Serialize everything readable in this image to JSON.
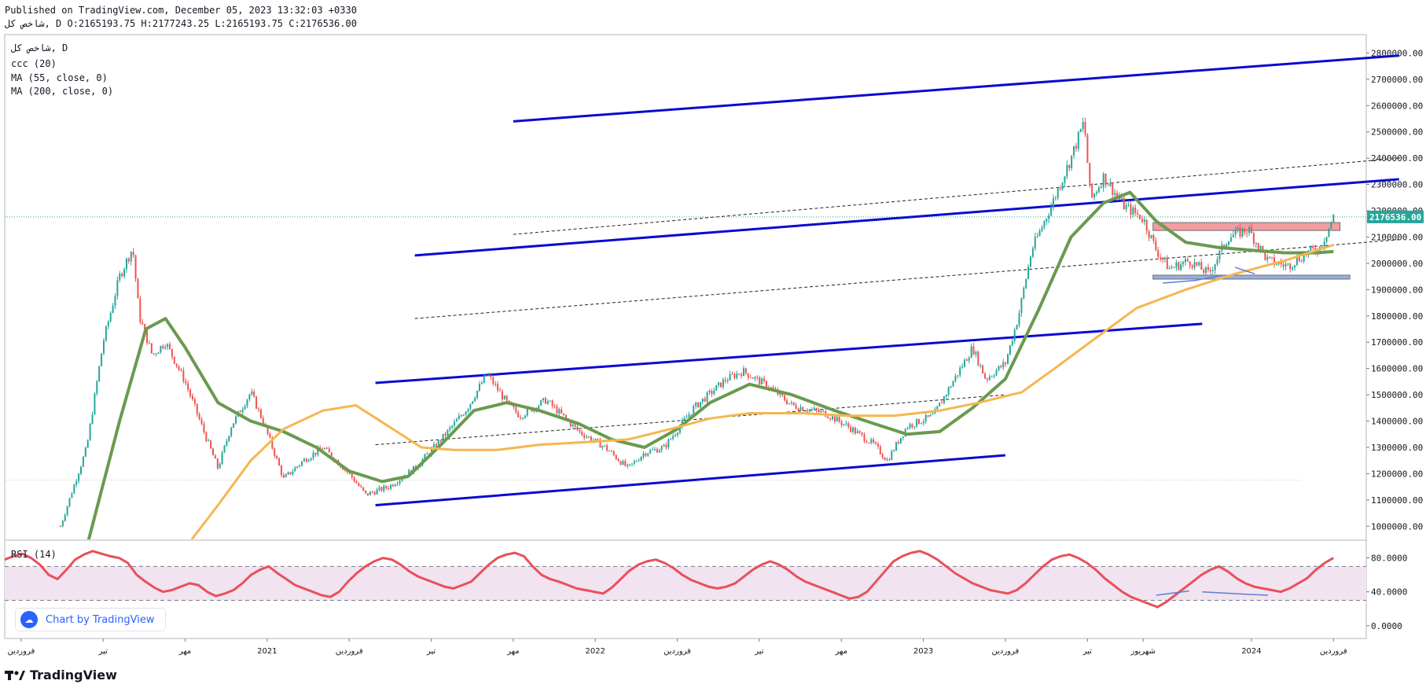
{
  "header": {
    "published": "Published on TradingView.com, December 05, 2023 13:32:03 +0330",
    "ohlc": "شاخص کل, D O:2165193.75 H:2177243.25 L:2165193.75 C:2176536.00"
  },
  "legend": {
    "symbol": "شاخص کل, D",
    "item2": "ccc (20)",
    "ma55": "MA (55, close, 0)",
    "ma200": "MA (200, close, 0)",
    "rsi": "RSI (14)"
  },
  "colors": {
    "up": "#26a69a",
    "down": "#ef5350",
    "ma55": "#6a9a4f",
    "ma200": "#f6b64f",
    "channel": "#0a0ad0",
    "rsi": "#e8505b",
    "rsiBand": "#f1e3f0",
    "red_zone": "#f28b91",
    "blue_zone": "#8aa0d6"
  },
  "branding": {
    "footer": "TradingView",
    "badge": "Chart by TradingView",
    "logo_icon": "tradingview-logo-icon",
    "badge_icon": "cloud-icon"
  },
  "chart_data": [
    {
      "type": "candlestick",
      "title": "",
      "last_price": "2176536.00",
      "y_ticks": [
        "2800000.00",
        "2700000.00",
        "2600000.00",
        "2500000.00",
        "2400000.00",
        "2300000.00",
        "2200000.00",
        "2100000.00",
        "2000000.00",
        "1900000.00",
        "1800000.00",
        "1700000.00",
        "1600000.00",
        "1500000.00",
        "1400000.00",
        "1300000.00",
        "1200000.00",
        "1100000.00",
        "1000000.00"
      ],
      "ylim": [
        950000,
        2870000
      ],
      "x_ticks": [
        {
          "label": "فروردین",
          "t": 0.0
        },
        {
          "label": "تیر",
          "t": 0.25
        },
        {
          "label": "مهر",
          "t": 0.5
        },
        {
          "label": "2021",
          "t": 0.75
        },
        {
          "label": "فروردین",
          "t": 1.0
        },
        {
          "label": "تیر",
          "t": 1.25
        },
        {
          "label": "مهر",
          "t": 1.5
        },
        {
          "label": "2022",
          "t": 1.75
        },
        {
          "label": "فروردین",
          "t": 2.0
        },
        {
          "label": "تیر",
          "t": 2.25
        },
        {
          "label": "مهر",
          "t": 2.5
        },
        {
          "label": "2023",
          "t": 2.75
        },
        {
          "label": "فروردین",
          "t": 3.0
        },
        {
          "label": "تیر",
          "t": 3.25
        },
        {
          "label": "شهریور",
          "t": 3.42
        },
        {
          "label": "2024",
          "t": 3.75
        },
        {
          "label": "فروردین",
          "t": 4.0
        }
      ],
      "xlim": [
        -0.05,
        4.1
      ],
      "price_path": [
        [
          0.12,
          1000000
        ],
        [
          0.2,
          1300000
        ],
        [
          0.25,
          1700000
        ],
        [
          0.3,
          1950000
        ],
        [
          0.34,
          2060000
        ],
        [
          0.36,
          1800000
        ],
        [
          0.4,
          1650000
        ],
        [
          0.44,
          1700000
        ],
        [
          0.5,
          1550000
        ],
        [
          0.56,
          1350000
        ],
        [
          0.6,
          1220000
        ],
        [
          0.64,
          1380000
        ],
        [
          0.7,
          1510000
        ],
        [
          0.74,
          1390000
        ],
        [
          0.8,
          1180000
        ],
        [
          0.86,
          1250000
        ],
        [
          0.92,
          1300000
        ],
        [
          1.0,
          1200000
        ],
        [
          1.05,
          1120000
        ],
        [
          1.12,
          1150000
        ],
        [
          1.2,
          1220000
        ],
        [
          1.28,
          1330000
        ],
        [
          1.36,
          1450000
        ],
        [
          1.42,
          1580000
        ],
        [
          1.48,
          1470000
        ],
        [
          1.52,
          1420000
        ],
        [
          1.6,
          1480000
        ],
        [
          1.7,
          1360000
        ],
        [
          1.78,
          1300000
        ],
        [
          1.85,
          1220000
        ],
        [
          1.9,
          1280000
        ],
        [
          1.96,
          1300000
        ],
        [
          2.05,
          1450000
        ],
        [
          2.15,
          1560000
        ],
        [
          2.2,
          1590000
        ],
        [
          2.28,
          1530000
        ],
        [
          2.35,
          1460000
        ],
        [
          2.45,
          1430000
        ],
        [
          2.52,
          1380000
        ],
        [
          2.6,
          1310000
        ],
        [
          2.64,
          1250000
        ],
        [
          2.7,
          1380000
        ],
        [
          2.78,
          1420000
        ],
        [
          2.84,
          1550000
        ],
        [
          2.9,
          1680000
        ],
        [
          2.94,
          1560000
        ],
        [
          3.0,
          1620000
        ],
        [
          3.04,
          1800000
        ],
        [
          3.08,
          2050000
        ],
        [
          3.14,
          2220000
        ],
        [
          3.2,
          2400000
        ],
        [
          3.24,
          2540000
        ],
        [
          3.26,
          2240000
        ],
        [
          3.3,
          2330000
        ],
        [
          3.36,
          2220000
        ],
        [
          3.42,
          2170000
        ],
        [
          3.46,
          2050000
        ],
        [
          3.5,
          1980000
        ],
        [
          3.56,
          2010000
        ],
        [
          3.62,
          1960000
        ],
        [
          3.68,
          2100000
        ],
        [
          3.74,
          2130000
        ],
        [
          3.8,
          2010000
        ],
        [
          3.86,
          1990000
        ],
        [
          3.92,
          2040000
        ],
        [
          3.96,
          2060000
        ],
        [
          4.0,
          2176536
        ]
      ],
      "ma55_path": [
        [
          0.2,
          920000
        ],
        [
          0.3,
          1400000
        ],
        [
          0.38,
          1750000
        ],
        [
          0.44,
          1790000
        ],
        [
          0.5,
          1680000
        ],
        [
          0.6,
          1470000
        ],
        [
          0.7,
          1400000
        ],
        [
          0.8,
          1360000
        ],
        [
          0.9,
          1300000
        ],
        [
          1.0,
          1210000
        ],
        [
          1.1,
          1170000
        ],
        [
          1.18,
          1190000
        ],
        [
          1.28,
          1310000
        ],
        [
          1.38,
          1440000
        ],
        [
          1.48,
          1470000
        ],
        [
          1.58,
          1440000
        ],
        [
          1.7,
          1390000
        ],
        [
          1.8,
          1330000
        ],
        [
          1.9,
          1300000
        ],
        [
          2.0,
          1370000
        ],
        [
          2.1,
          1470000
        ],
        [
          2.22,
          1540000
        ],
        [
          2.35,
          1500000
        ],
        [
          2.48,
          1440000
        ],
        [
          2.6,
          1390000
        ],
        [
          2.7,
          1350000
        ],
        [
          2.8,
          1360000
        ],
        [
          2.9,
          1450000
        ],
        [
          3.0,
          1560000
        ],
        [
          3.1,
          1820000
        ],
        [
          3.2,
          2100000
        ],
        [
          3.3,
          2230000
        ],
        [
          3.38,
          2270000
        ],
        [
          3.46,
          2160000
        ],
        [
          3.55,
          2080000
        ],
        [
          3.65,
          2060000
        ],
        [
          3.75,
          2050000
        ],
        [
          3.85,
          2040000
        ],
        [
          3.95,
          2040000
        ],
        [
          4.0,
          2045000
        ]
      ],
      "ma200_path": [
        [
          0.52,
          950000
        ],
        [
          0.6,
          1080000
        ],
        [
          0.7,
          1250000
        ],
        [
          0.8,
          1370000
        ],
        [
          0.92,
          1440000
        ],
        [
          1.02,
          1460000
        ],
        [
          1.12,
          1380000
        ],
        [
          1.22,
          1300000
        ],
        [
          1.32,
          1290000
        ],
        [
          1.45,
          1290000
        ],
        [
          1.58,
          1310000
        ],
        [
          1.72,
          1320000
        ],
        [
          1.85,
          1330000
        ],
        [
          1.98,
          1370000
        ],
        [
          2.1,
          1410000
        ],
        [
          2.22,
          1430000
        ],
        [
          2.38,
          1430000
        ],
        [
          2.52,
          1420000
        ],
        [
          2.66,
          1420000
        ],
        [
          2.8,
          1440000
        ],
        [
          2.92,
          1470000
        ],
        [
          3.05,
          1510000
        ],
        [
          3.15,
          1600000
        ],
        [
          3.28,
          1720000
        ],
        [
          3.4,
          1830000
        ],
        [
          3.55,
          1900000
        ],
        [
          3.7,
          1960000
        ],
        [
          3.85,
          2010000
        ],
        [
          4.0,
          2070000
        ]
      ],
      "channel_lines": [
        {
          "from": [
            1.5,
            2540000
          ],
          "to": [
            4.2,
            2790000
          ],
          "style": "solid"
        },
        {
          "from": [
            1.5,
            2110000
          ],
          "to": [
            4.2,
            2400000
          ],
          "style": "dashed"
        },
        {
          "from": [
            1.2,
            2030000
          ],
          "to": [
            4.2,
            2320000
          ],
          "style": "solid"
        },
        {
          "from": [
            1.2,
            1790000
          ],
          "to": [
            4.2,
            2090000
          ],
          "style": "dashed"
        },
        {
          "from": [
            1.08,
            1545000
          ],
          "to": [
            3.6,
            1770000
          ],
          "style": "solid"
        },
        {
          "from": [
            1.08,
            1310000
          ],
          "to": [
            3.0,
            1500000
          ],
          "style": "dashed"
        },
        {
          "from": [
            1.08,
            1080000
          ],
          "to": [
            3.0,
            1270000
          ],
          "style": "solid"
        }
      ],
      "zones": [
        {
          "name": "resistance",
          "x": [
            3.45,
            4.02
          ],
          "y": [
            2125000,
            2155000
          ],
          "color": "red_zone"
        },
        {
          "name": "support",
          "x": [
            3.45,
            4.05
          ],
          "y": [
            1940000,
            1955000
          ],
          "color": "blue_zone"
        }
      ]
    },
    {
      "type": "line",
      "name": "RSI (14)",
      "y_ticks": [
        "80.0000",
        "40.0000",
        "0.0000"
      ],
      "ylim": [
        -15,
        100
      ],
      "bands": [
        70,
        30
      ],
      "values": [
        78,
        82,
        85,
        80,
        72,
        60,
        55,
        66,
        78,
        84,
        88,
        85,
        82,
        80,
        74,
        60,
        52,
        45,
        40,
        42,
        46,
        50,
        48,
        40,
        35,
        38,
        42,
        50,
        60,
        66,
        70,
        62,
        55,
        48,
        44,
        40,
        36,
        34,
        40,
        52,
        62,
        70,
        76,
        80,
        78,
        72,
        64,
        58,
        54,
        50,
        46,
        44,
        48,
        52,
        62,
        72,
        80,
        84,
        86,
        82,
        70,
        60,
        55,
        52,
        48,
        44,
        42,
        40,
        38,
        45,
        55,
        65,
        72,
        76,
        78,
        74,
        68,
        60,
        54,
        50,
        46,
        44,
        46,
        50,
        58,
        66,
        72,
        76,
        72,
        66,
        58,
        52,
        48,
        44,
        40,
        36,
        32,
        34,
        40,
        52,
        64,
        76,
        82,
        86,
        88,
        84,
        78,
        70,
        62,
        56,
        50,
        46,
        42,
        40,
        38,
        42,
        50,
        60,
        70,
        78,
        82,
        84,
        80,
        74,
        66,
        56,
        48,
        40,
        34,
        30,
        26,
        22,
        28,
        36,
        44,
        52,
        60,
        66,
        70,
        64,
        56,
        50,
        46,
        44,
        42,
        40,
        44,
        50,
        56,
        66,
        74,
        80
      ]
    }
  ]
}
